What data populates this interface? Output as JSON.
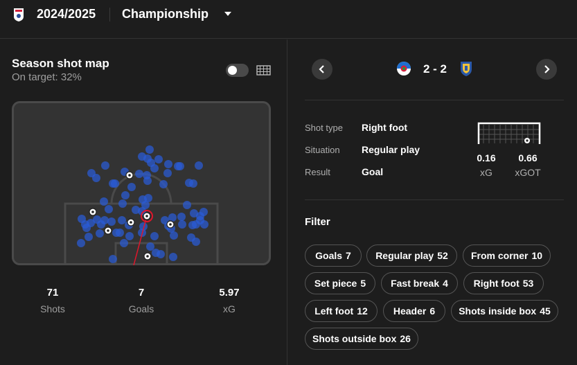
{
  "header": {
    "season": "2024/2025",
    "league": "Championship",
    "league_logo_icon": "efl-championship-logo",
    "caret_icon": "caret-down-icon"
  },
  "shot_map": {
    "title": "Season shot map",
    "subtitle": "On target: 32%",
    "stats": [
      {
        "value": "71",
        "label": "Shots"
      },
      {
        "value": "7",
        "label": "Goals"
      },
      {
        "value": "5.97",
        "label": "xG"
      }
    ]
  },
  "match": {
    "score": "2 - 2",
    "home_crest": "blackburn-rovers-crest",
    "away_crest": "sheffield-wednesday-crest"
  },
  "shot_details": {
    "rows": [
      {
        "label": "Shot type",
        "value": "Right foot"
      },
      {
        "label": "Situation",
        "value": "Regular play"
      },
      {
        "label": "Result",
        "value": "Goal"
      }
    ],
    "xg": {
      "value": "0.16",
      "label": "xG"
    },
    "xgot": {
      "value": "0.66",
      "label": "xGOT"
    }
  },
  "filter": {
    "title": "Filter",
    "chips": [
      {
        "label": "Goals",
        "count": "7"
      },
      {
        "label": "Regular play",
        "count": "52"
      },
      {
        "label": "From corner",
        "count": "10"
      },
      {
        "label": "Set piece",
        "count": "5"
      },
      {
        "label": "Fast break",
        "count": "4"
      },
      {
        "label": "Right foot",
        "count": "53"
      },
      {
        "label": "Left foot",
        "count": "12"
      },
      {
        "label": "Header",
        "count": "6"
      },
      {
        "label": "Shots inside box",
        "count": "45"
      },
      {
        "label": "Shots outside box",
        "count": "26"
      }
    ]
  },
  "colors": {
    "background": "#1d1d1d",
    "pitch": "#333333",
    "shot": "#2a5bd7",
    "selected_ring": "#e0162b"
  }
}
